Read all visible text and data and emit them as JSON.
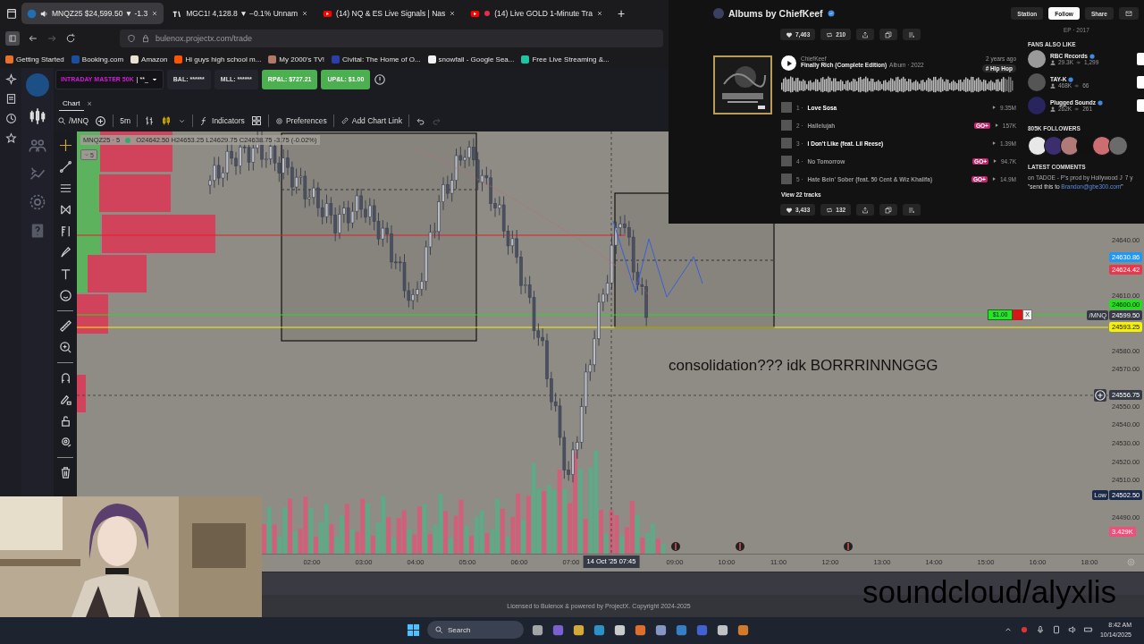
{
  "browser": {
    "tabs": [
      {
        "kind": "trading",
        "label": "MNQZ25 $24,599.50 ▼ -1.3",
        "selected": true,
        "audio": true
      },
      {
        "kind": "chart",
        "label": "MGC1! 4,128.8 ▼ −0.1% Unnam",
        "selected": false,
        "audio": false
      },
      {
        "kind": "video",
        "label": "(14) NQ & ES Live Signals | Nas",
        "selected": false,
        "audio": false
      },
      {
        "kind": "live",
        "label": "(14) Live GOLD 1-Minute Tra",
        "selected": false,
        "audio": false
      }
    ],
    "new_tab": "+",
    "url": "bulenox.projectx.com/trade",
    "bookmarks": [
      {
        "label": "Getting Started",
        "color": "#e8702a"
      },
      {
        "label": "Booking.com",
        "color": "#1a4fa0"
      },
      {
        "label": "Amazon",
        "color": "#e8e2d0"
      },
      {
        "label": "Hi guys high school m...",
        "color": "#ff5500"
      },
      {
        "label": "My 2000's TV!",
        "color": "#b07a68"
      },
      {
        "label": "Civitai: The Home of O...",
        "color": "#2c3ea8"
      },
      {
        "label": "snowfall - Google Sea...",
        "color": "#f2f2f2"
      },
      {
        "label": "Free Live Streaming &...",
        "color": "#1fc4a2"
      }
    ]
  },
  "app": {
    "account": {
      "name": "INTRADAY MASTER 50K",
      "masked": "| **_"
    },
    "stats": [
      {
        "label": "BAL: ******",
        "kind": "plain"
      },
      {
        "label": "MLL: ******",
        "kind": "plain"
      },
      {
        "label": "RP&L: $727.21",
        "kind": "profit"
      },
      {
        "label": "UP&L: $1.00",
        "kind": "profit"
      }
    ],
    "panel_tabs": [
      {
        "label": "Chart",
        "selected": true,
        "close": "×"
      }
    ],
    "toolbar": {
      "symbol": "/MNQ",
      "interval": "5m",
      "indicators": "Indicators",
      "preferences": "Preferences",
      "chart_link": "Add Chart Link"
    }
  },
  "chart": {
    "legend": {
      "symbol": "MNQZ25 · 5",
      "ohlc": "O24642.50 H24653.25 L24629.75 C24638.75 -3.75 (-0.02%)",
      "collapsed_count": "5"
    },
    "order": {
      "pnl": "$1.00",
      "close": "X"
    },
    "price_axis": [
      "24640.00",
      "24610.00",
      "24580.00",
      "24570.00",
      "24550.00",
      "24540.00",
      "24530.00",
      "24520.00",
      "24510.00",
      "24490.00"
    ],
    "time_axis": [
      "02:00",
      "03:00",
      "04:00",
      "05:00",
      "06:00",
      "07:00",
      "09:00",
      "10:00",
      "11:00",
      "12:00",
      "13:00",
      "14:00",
      "15:00",
      "16:00",
      "18:00"
    ],
    "crosshair_time": "14 Oct '25  07:45",
    "price_tags": [
      {
        "kind": "tag",
        "label": "24630.86",
        "color": "#2196f3"
      },
      {
        "kind": "tag",
        "label": "24624.42",
        "color": "#e53950"
      },
      {
        "kind": "line_tag",
        "label": "24600.00",
        "color": "#22e01c"
      },
      {
        "kind": "tag",
        "label": "24599.50",
        "color": "#363a45",
        "prefix": "/MNQ"
      },
      {
        "kind": "line_tag",
        "label": "24593.25",
        "color": "#f5f00a"
      },
      {
        "kind": "crosshair",
        "label": "24556.75",
        "color": "#363a45"
      },
      {
        "kind": "tag",
        "label": "24502.50",
        "color": "#1c2a4a",
        "prefix": "Low"
      },
      {
        "kind": "tag",
        "label": "3.429K",
        "color": "#ef4f78"
      }
    ],
    "note": "consolidation??? idk BORRRINNNGGG"
  },
  "footer": "Licensed to Bulenox & powered by ProjectX. Copyright 2024-2025",
  "soundcloud": {
    "title": "Albums by ChiefKeef",
    "verified": true,
    "buttons": [
      {
        "label": "Station",
        "kind": "secondary"
      },
      {
        "label": "Follow",
        "kind": "primary"
      },
      {
        "label": "Share",
        "kind": "secondary"
      }
    ],
    "previous_album": {
      "likes": "7,463",
      "reposts": "210"
    },
    "album": {
      "artist": "ChiefKeef",
      "title": "Finally Rich (Complete Edition)",
      "meta": "Album · 2022",
      "age": "2 years ago",
      "tag": "# Hip Hop",
      "tracks": [
        {
          "number": "1 ·",
          "title": "Love Sosa",
          "plays": "9.35M"
        },
        {
          "number": "2 ·",
          "title": "Hallelujah",
          "plays": "157K",
          "badge": "GO+"
        },
        {
          "number": "3 ·",
          "title": "I Don't Like (feat. Lil Reese)",
          "plays": "1.39M"
        },
        {
          "number": "4 ·",
          "title": "No Tomorrow",
          "plays": "94.7K",
          "badge": "GO+"
        },
        {
          "number": "5 ·",
          "title": "Hate Bein' Sober (feat. 50 Cent & Wiz Khalifa)",
          "plays": "14.9M",
          "badge": "GO+"
        }
      ],
      "more": "View 22 tracks",
      "likes": "3,433",
      "reposts": "132"
    },
    "sidebar": {
      "previous": "EP · 2017",
      "fans_heading": "FANS ALSO LIKE",
      "artists": [
        {
          "name": "RBC Records",
          "followers": "29.3K",
          "tracks": "1,299",
          "color": "#9a9a9a"
        },
        {
          "name": "TAY-K",
          "followers": "468K",
          "tracks": "66",
          "color": "#555555"
        },
        {
          "name": "Plugged Soundz",
          "followers": "262K",
          "tracks": "261",
          "color": "#27245e"
        }
      ],
      "followers_heading": "805K FOLLOWERS",
      "comments_heading": "LATEST COMMENTS",
      "comment_on": "on TADOE - P's prod by Hollywood J",
      "comment_age": "7 y",
      "comment_prefix": "\"send this to ",
      "comment_link": "Brandon@gbe300.com",
      "comment_suffix": "\""
    }
  },
  "stream_overlay": {
    "caption": "soundcloud/alyxlis"
  },
  "taskbar": {
    "search": "Search",
    "time": "8:42 AM",
    "date": "10/14/2025"
  }
}
